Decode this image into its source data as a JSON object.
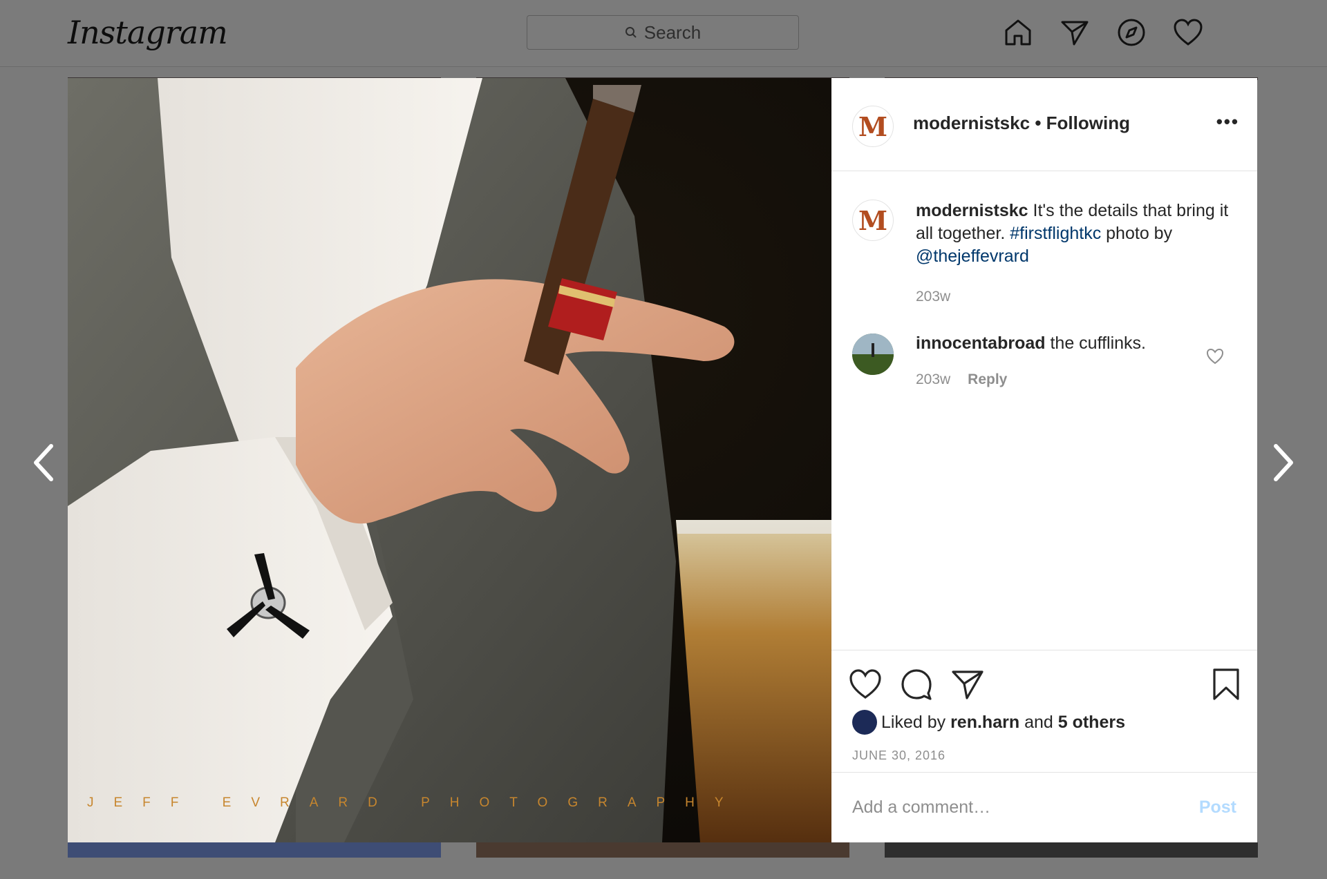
{
  "header": {
    "logo": "Instagram",
    "search_placeholder": "Search"
  },
  "photo": {
    "watermark": "JEFF EVRARD PHOTOGRAPHY"
  },
  "post": {
    "author": "modernistskc",
    "separator": "•",
    "follow_state": "Following",
    "more": "•••",
    "avatar_letter": "M",
    "caption": {
      "username": "modernistskc",
      "text": "It's the details that bring it all together.",
      "hashtag": "#firstflightkc",
      "text2": "photo by",
      "mention": "@thejeffevrard",
      "time": "203w"
    },
    "comments": [
      {
        "username": "innocentabroad",
        "text": "the cufflinks.",
        "time": "203w",
        "reply": "Reply"
      }
    ],
    "likes": {
      "prefix": "Liked by",
      "user": "ren.harn",
      "and": "and",
      "others": "5 others"
    },
    "date": "JUNE 30, 2016",
    "add_comment_placeholder": "Add a comment…",
    "post_label": "Post"
  }
}
